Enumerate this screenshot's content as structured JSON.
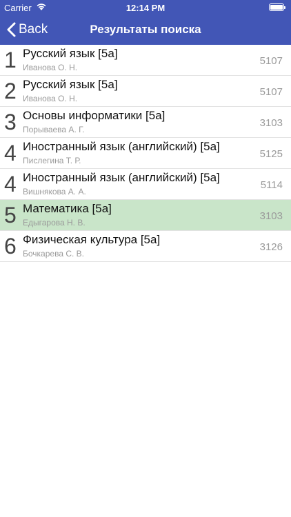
{
  "status": {
    "carrier": "Carrier",
    "time": "12:14 PM"
  },
  "nav": {
    "back_label": "Back",
    "title": "Результаты поиска"
  },
  "results": [
    {
      "num": "1",
      "subject": "Русский язык [5а]",
      "teacher": "Иванова О. Н.",
      "room": "5107"
    },
    {
      "num": "2",
      "subject": "Русский язык [5а]",
      "teacher": "Иванова О. Н.",
      "room": "5107"
    },
    {
      "num": "3",
      "subject": "Основы информатики [5а]",
      "teacher": "Порываева А. Г.",
      "room": "3103"
    },
    {
      "num": "4",
      "subject": "Иностранный язык (английский) [5а]",
      "teacher": "Пислегина Т. Р.",
      "room": "5125"
    },
    {
      "num": "4",
      "subject": "Иностранный язык (английский) [5а]",
      "teacher": "Вишнякова А. А.",
      "room": "5114"
    },
    {
      "num": "5",
      "subject": "Математика [5а]",
      "teacher": "Едыгарова Н. В.",
      "room": "3103"
    },
    {
      "num": "6",
      "subject": "Физическая культура [5а]",
      "teacher": "Бочкарева С. В.",
      "room": "3126"
    }
  ],
  "selected_index": 5,
  "colors": {
    "nav_bar": "#4256b6",
    "selected_row": "#c9e5c9"
  }
}
